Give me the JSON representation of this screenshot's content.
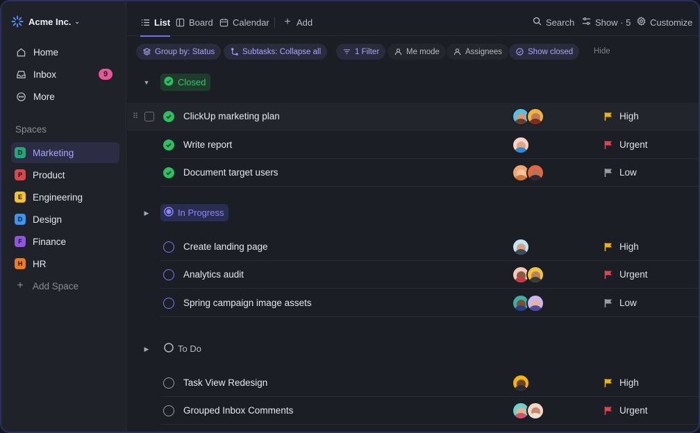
{
  "workspace": {
    "name": "Acme Inc.",
    "chevron": "chevron-down-icon"
  },
  "nav": [
    {
      "label": "Home",
      "icon": "home-icon"
    },
    {
      "label": "Inbox",
      "icon": "inbox-icon",
      "badge": "9"
    },
    {
      "label": "More",
      "icon": "more-icon"
    }
  ],
  "spaces": {
    "heading": "Spaces",
    "items": [
      {
        "letter": "D",
        "label": "Marketing",
        "color": "#24a57c",
        "active": true
      },
      {
        "letter": "P",
        "label": "Product",
        "color": "#d9464d"
      },
      {
        "letter": "E",
        "label": "Engineering",
        "color": "#f4c330"
      },
      {
        "letter": "D",
        "label": "Design",
        "color": "#3e95f0"
      },
      {
        "letter": "F",
        "label": "Finance",
        "color": "#8e57e0"
      },
      {
        "letter": "H",
        "label": "HR",
        "color": "#f07a1f"
      }
    ],
    "add_label": "Add Space"
  },
  "views": {
    "tabs": [
      {
        "label": "List",
        "icon": "list-icon",
        "active": true
      },
      {
        "label": "Board",
        "icon": "board-icon"
      },
      {
        "label": "Calendar",
        "icon": "calendar-icon"
      }
    ],
    "add_label": "Add",
    "search_label": "Search",
    "show_label": "Show · 5",
    "customize_label": "Customize"
  },
  "filters": {
    "group_by": "Group by: Status",
    "subtasks": "Subtasks: Collapse all",
    "filter": "1 Filter",
    "me_mode": "Me mode",
    "assignees": "Assignees",
    "show_closed": "Show closed",
    "hide": "Hide"
  },
  "groups": [
    {
      "status": "Closed",
      "tasks": [
        {
          "name": "ClickUp marketing plan",
          "priority": "High"
        },
        {
          "name": "Write report",
          "priority": "Urgent"
        },
        {
          "name": "Document target users",
          "priority": "Low"
        }
      ]
    },
    {
      "status": "In Progress",
      "tasks": [
        {
          "name": "Create landing page",
          "priority": "High"
        },
        {
          "name": "Analytics audit",
          "priority": "Urgent"
        },
        {
          "name": "Spring campaign image assets",
          "priority": "Low"
        }
      ]
    },
    {
      "status": "To Do",
      "tasks": [
        {
          "name": "Task View Redesign",
          "priority": "High"
        },
        {
          "name": "Grouped Inbox Comments",
          "priority": "Urgent"
        }
      ]
    }
  ],
  "colors": {
    "accent": "#7b6cf6",
    "closed": "#2fbd61",
    "in_progress": "#7f78f0",
    "high": "#f4b400",
    "urgent": "#e0444e",
    "low": "#9a9ca5"
  }
}
